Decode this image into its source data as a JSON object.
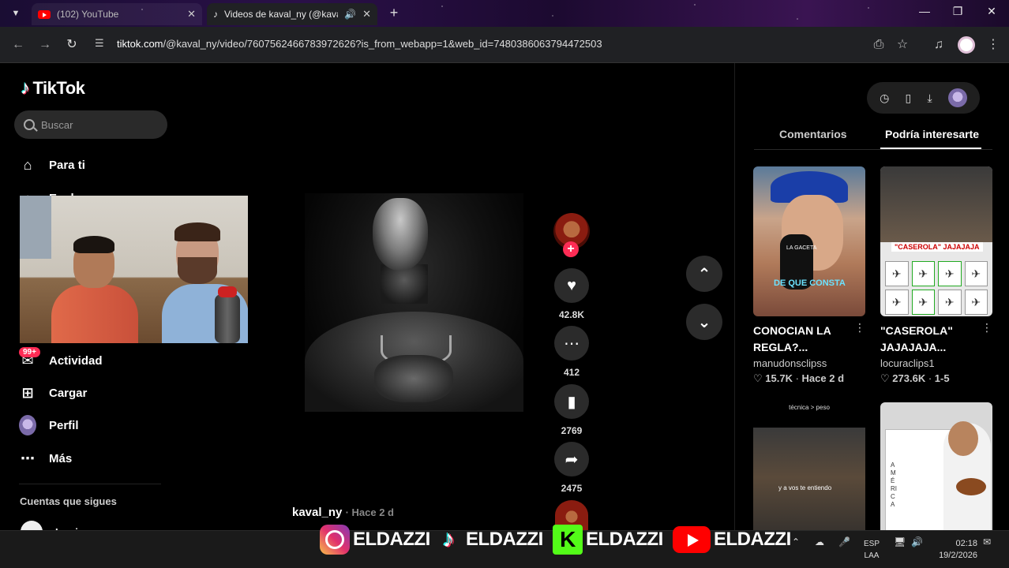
{
  "browser": {
    "tabs": [
      {
        "label": "(102) YouTube",
        "active": false
      },
      {
        "label": "Videos de kaval_ny (@kaval",
        "active": true
      }
    ],
    "url_domain": "tiktok.com",
    "url_path": "/@kaval_ny/video/7607562466783972626?is_from_webapp=1&web_id=7480386063794472503"
  },
  "sidebar": {
    "logo": "TikTok",
    "search_placeholder": "Buscar",
    "items": [
      {
        "label": "Para ti",
        "icon": "home-icon"
      },
      {
        "label": "Explorar",
        "icon": "compass-icon"
      },
      {
        "label": "Actividad",
        "icon": "inbox-icon",
        "badge": "99+"
      },
      {
        "label": "Cargar",
        "icon": "plus-square-icon"
      },
      {
        "label": "Perfil",
        "icon": "avatar"
      },
      {
        "label": "Más",
        "icon": "more-icon"
      }
    ],
    "following_title": "Cuentas que sigues",
    "following": [
      "Lewisss"
    ]
  },
  "video": {
    "author": "kaval_ny",
    "time": "Hace 2 d",
    "likes": "42.8K",
    "comments": "412",
    "saves": "2769",
    "shares": "2475"
  },
  "right_panel": {
    "tabs": [
      "Comentarios",
      "Podría interesarte"
    ],
    "active_tab": "Podría interesarte",
    "cards": [
      {
        "title": "CONOCIAN LA REGLA?...",
        "author": "manudonsclipss",
        "likes": "15.7K",
        "time": "Hace 2 d",
        "thumb_text": "DE QUE CONSTA",
        "mic_text": "LA GACETA"
      },
      {
        "title": "\"CASEROLA\" JAJAJAJA...",
        "author": "locuraclips1",
        "likes": "273.6K",
        "time": "1-5",
        "thumb_text": "\"CASEROLA\" JAJAJAJA"
      },
      {
        "thumb_text": "técnica > peso",
        "sub_text": "y a vos te entiendo"
      },
      {
        "thumb_text": "AMÉRICA"
      }
    ]
  },
  "overlay": {
    "handles": [
      "ELDAZZI",
      "ELDAZZI",
      "ELDAZZI",
      "ELDAZZI"
    ],
    "lang_top": "ESP",
    "lang_bottom": "LAA",
    "time": "02:18",
    "date": "19/2/2026"
  }
}
